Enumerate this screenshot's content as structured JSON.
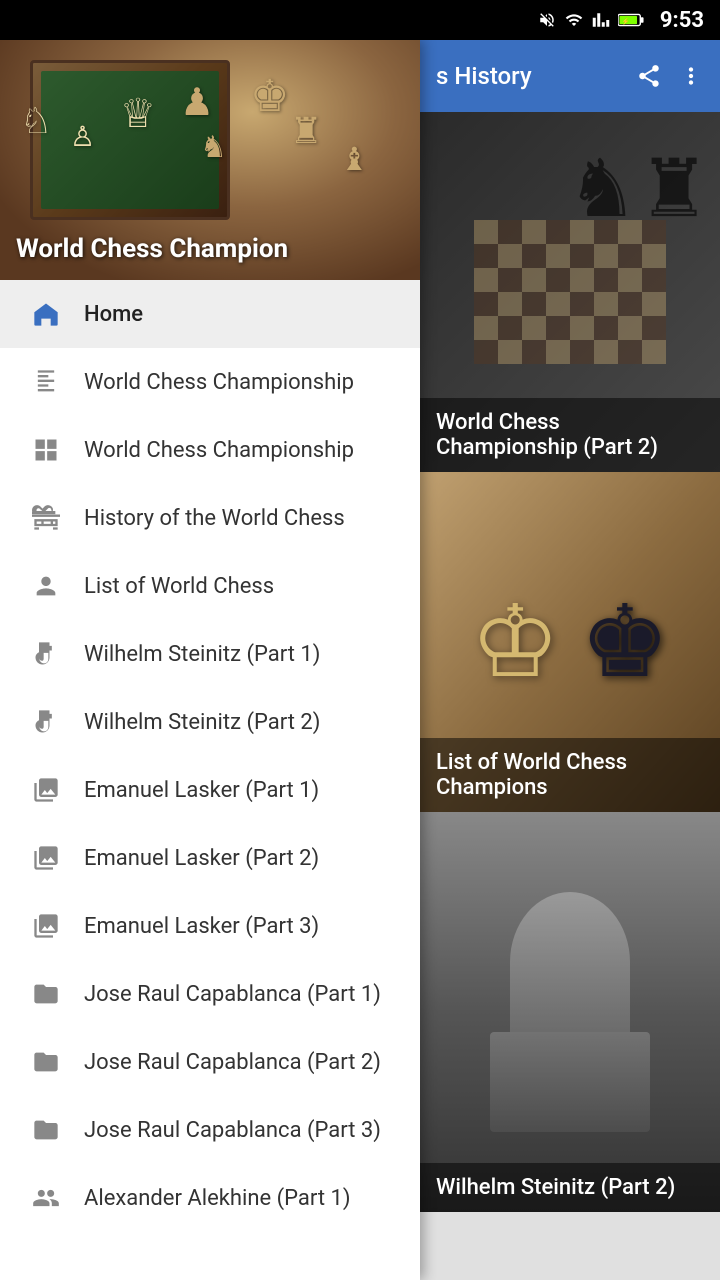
{
  "statusBar": {
    "time": "9:53",
    "icons": [
      "mute",
      "wifi",
      "signal",
      "battery"
    ]
  },
  "appBar": {
    "title": "s History",
    "shareLabel": "share",
    "moreLabel": "more"
  },
  "drawer": {
    "headerTitle": "World Chess Champion",
    "navItems": [
      {
        "id": "home",
        "label": "Home",
        "icon": "🏛",
        "active": true
      },
      {
        "id": "wcc1",
        "label": "World Chess Championship",
        "icon": "📊",
        "active": false
      },
      {
        "id": "wcc2",
        "label": "World Chess Championship",
        "icon": "⊞",
        "active": false
      },
      {
        "id": "history",
        "label": "History of the World Chess",
        "icon": "🗂",
        "active": false
      },
      {
        "id": "list",
        "label": "List of World Chess",
        "icon": "👤",
        "active": false
      },
      {
        "id": "steinitz1",
        "label": "Wilhelm Steinitz (Part 1)",
        "icon": "📡",
        "active": false
      },
      {
        "id": "steinitz2",
        "label": "Wilhelm Steinitz (Part 2)",
        "icon": "📡",
        "active": false
      },
      {
        "id": "lasker1",
        "label": "Emanuel Lasker (Part 1)",
        "icon": "≡📷",
        "active": false
      },
      {
        "id": "lasker2",
        "label": "Emanuel Lasker (Part 2)",
        "icon": "≡📷",
        "active": false
      },
      {
        "id": "lasker3",
        "label": "Emanuel Lasker (Part 3)",
        "icon": "≡📷",
        "active": false
      },
      {
        "id": "capa1",
        "label": "Jose Raul Capablanca (Part 1)",
        "icon": "📁",
        "active": false
      },
      {
        "id": "capa2",
        "label": "Jose Raul Capablanca (Part 2)",
        "icon": "📁",
        "active": false
      },
      {
        "id": "capa3",
        "label": "Jose Raul Capablanca (Part 3)",
        "icon": "📁",
        "active": false
      },
      {
        "id": "alek1",
        "label": "Alexander Alekhine (Part 1)",
        "icon": "👤",
        "active": false
      }
    ]
  },
  "cards": [
    {
      "id": "card1",
      "title": "World Chess Championship (Part 2)"
    },
    {
      "id": "card2",
      "title": "List of World Chess Champions"
    },
    {
      "id": "card3",
      "title": "Wilhelm Steinitz (Part 2)"
    }
  ]
}
